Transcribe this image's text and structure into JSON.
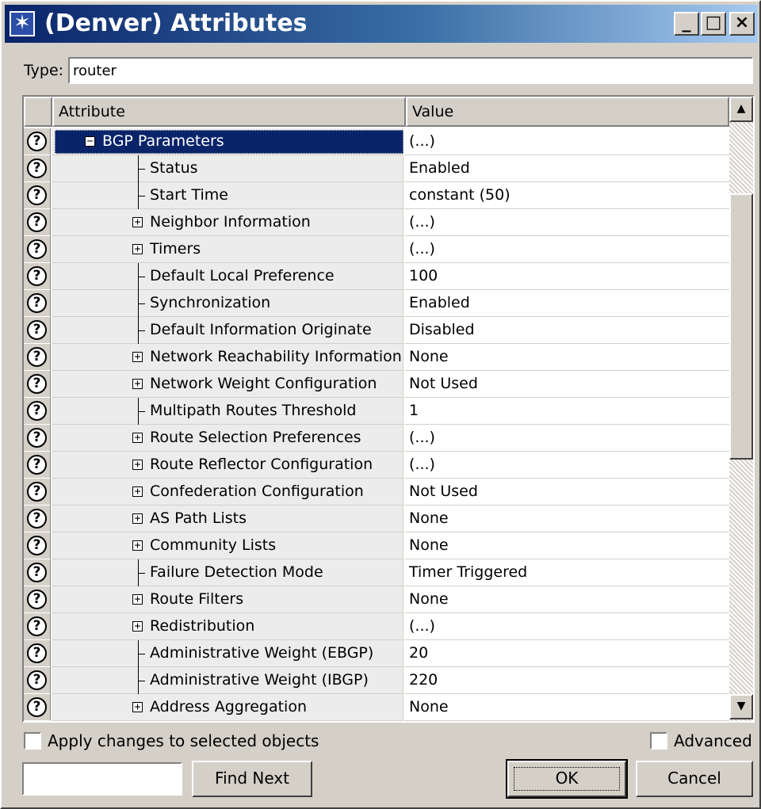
{
  "window": {
    "title": "(Denver) Attributes",
    "buttons": {
      "minimize": "_",
      "maximize": "□",
      "close": "×"
    }
  },
  "type_field": {
    "label": "Type:",
    "value": "router"
  },
  "grid": {
    "columns": {
      "help": "",
      "attribute": "Attribute",
      "value": "Value"
    },
    "rows": [
      {
        "attr": "BGP Parameters",
        "value": "(...)",
        "kind": "group-open",
        "selected": true
      },
      {
        "attr": "Status",
        "value": "Enabled",
        "kind": "leaf"
      },
      {
        "attr": "Start Time",
        "value": "constant (50)",
        "kind": "leaf"
      },
      {
        "attr": "Neighbor Information",
        "value": "(...)",
        "kind": "expand"
      },
      {
        "attr": "Timers",
        "value": "(...)",
        "kind": "expand"
      },
      {
        "attr": "Default Local Preference",
        "value": "100",
        "kind": "leaf"
      },
      {
        "attr": "Synchronization",
        "value": "Enabled",
        "kind": "leaf"
      },
      {
        "attr": "Default Information Originate",
        "value": "Disabled",
        "kind": "leaf"
      },
      {
        "attr": "Network Reachability Information",
        "value": "None",
        "kind": "expand"
      },
      {
        "attr": "Network Weight Configuration",
        "value": "Not Used",
        "kind": "expand"
      },
      {
        "attr": "Multipath Routes Threshold",
        "value": "1",
        "kind": "leaf"
      },
      {
        "attr": "Route Selection Preferences",
        "value": "(...)",
        "kind": "expand"
      },
      {
        "attr": "Route Reflector Configuration",
        "value": "(...)",
        "kind": "expand"
      },
      {
        "attr": "Confederation Configuration",
        "value": "Not Used",
        "kind": "expand"
      },
      {
        "attr": "AS Path Lists",
        "value": "None",
        "kind": "expand"
      },
      {
        "attr": "Community Lists",
        "value": "None",
        "kind": "expand"
      },
      {
        "attr": "Failure Detection Mode",
        "value": "Timer Triggered",
        "kind": "leaf"
      },
      {
        "attr": "Route Filters",
        "value": "None",
        "kind": "expand"
      },
      {
        "attr": "Redistribution",
        "value": "(...)",
        "kind": "expand"
      },
      {
        "attr": "Administrative Weight (EBGP)",
        "value": "20",
        "kind": "leaf"
      },
      {
        "attr": "Administrative Weight (IBGP)",
        "value": "220",
        "kind": "leaf"
      },
      {
        "attr": "Address Aggregation",
        "value": "None",
        "kind": "expand"
      }
    ]
  },
  "options": {
    "apply_label": "Apply changes to selected objects",
    "apply_checked": false,
    "advanced_label": "Advanced",
    "advanced_checked": false
  },
  "footer": {
    "find_value": "",
    "find_next_label": "Find Next",
    "ok_label": "OK",
    "cancel_label": "Cancel"
  },
  "colors": {
    "titlebar_start": "#0a246a",
    "selection": "#0a246a",
    "face": "#d4d0c8"
  },
  "icons": {
    "app": "network-icon",
    "help": "question-mark-icon",
    "expand": "plus-box-icon",
    "collapse": "minus-box-icon"
  }
}
